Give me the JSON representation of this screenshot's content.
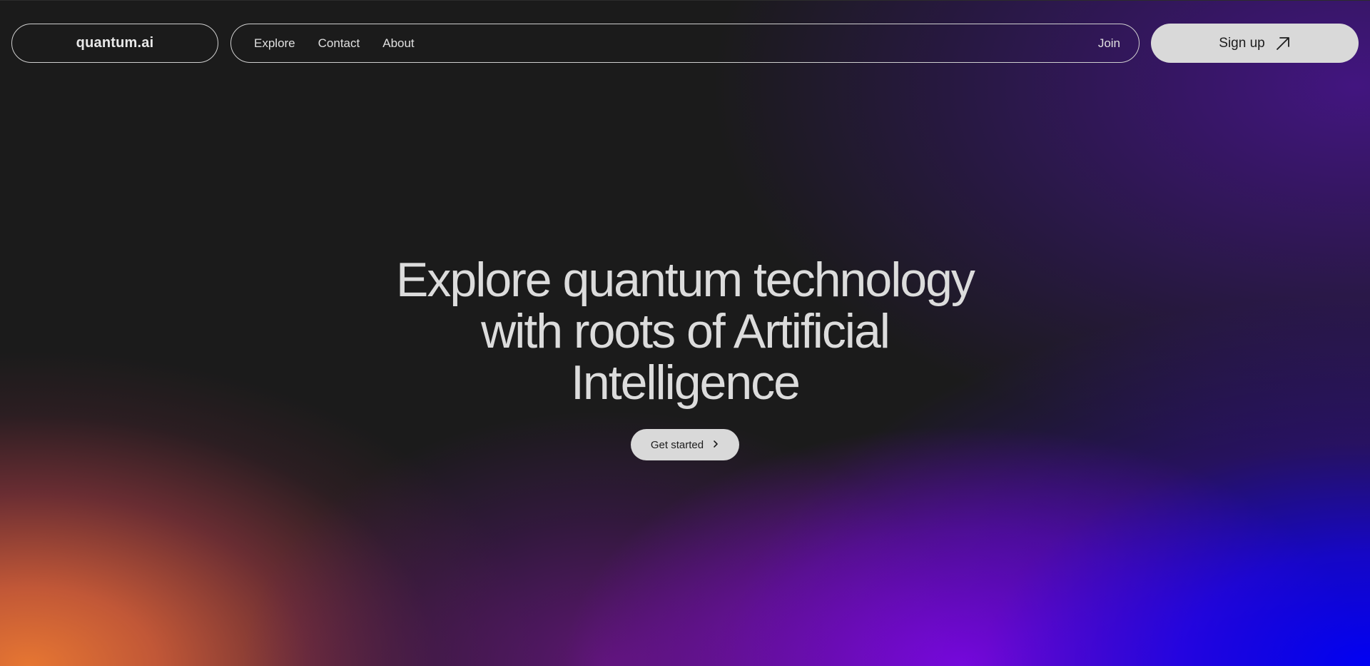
{
  "brand": {
    "logo_text": "quantum.ai"
  },
  "nav": {
    "links": [
      {
        "label": "Explore"
      },
      {
        "label": "Contact"
      },
      {
        "label": "About"
      }
    ],
    "join_label": "Join"
  },
  "signup": {
    "label": "Sign up",
    "icon": "arrow-up-right-icon"
  },
  "hero": {
    "title_line_1": "Explore quantum technology",
    "title_line_2": "with roots of Artificial",
    "title_line_3": "Intelligence",
    "cta_label": "Get started",
    "cta_icon": "chevron-right-icon"
  },
  "colors": {
    "background": "#1b1b1b",
    "text": "#dcdcdc",
    "button_fill": "#d9d9d9",
    "gradient_orange": "#e6763a",
    "gradient_purple": "#9610e6",
    "gradient_blue": "#0000ff"
  }
}
